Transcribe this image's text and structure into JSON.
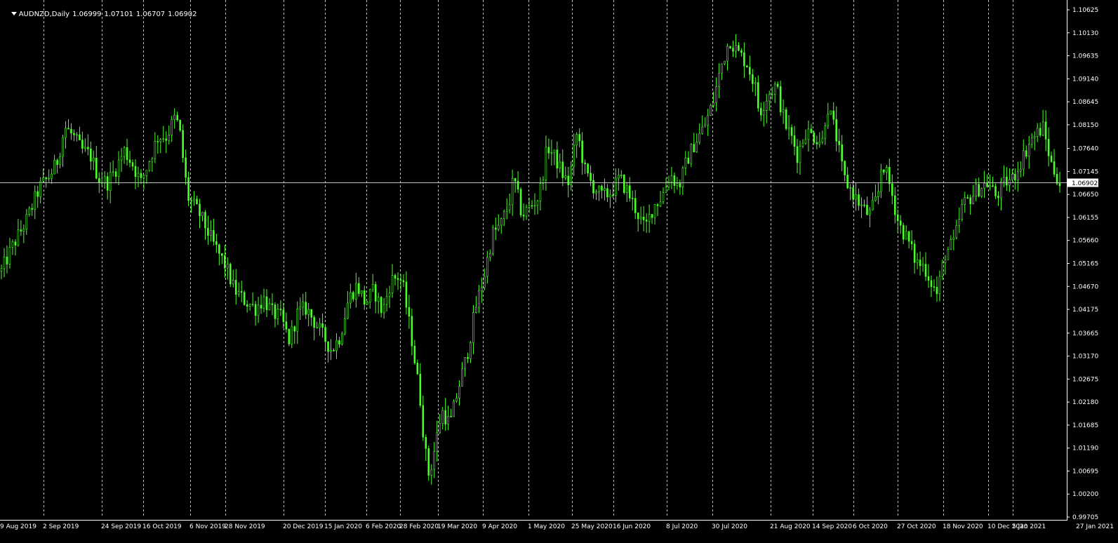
{
  "header": {
    "symbol": "AUDNZD,Daily",
    "open": "1.06999",
    "high": "1.07101",
    "low": "1.06707",
    "close": "1.06902"
  },
  "colors": {
    "background": "#000000",
    "grid": "#c0c0c0",
    "candle": "#4bff2a",
    "axis_text": "#ffffff",
    "price_line": "#c0c0c0",
    "price_label_bg": "#ffffff",
    "price_label_text": "#000000"
  },
  "chart_data": {
    "type": "candlestick",
    "symbol": "AUDNZD",
    "timeframe": "Daily",
    "current_price": 1.06902,
    "current_price_label": "1.06902",
    "ylim": [
      0.99705,
      1.10625
    ],
    "y_ticks": [
      "1.10625",
      "1.10130",
      "1.09635",
      "1.09140",
      "1.08645",
      "1.08150",
      "1.07640",
      "1.07145",
      "1.06650",
      "1.06155",
      "1.05660",
      "1.05165",
      "1.04670",
      "1.04175",
      "1.03665",
      "1.03170",
      "1.02675",
      "1.02180",
      "1.01685",
      "1.01190",
      "1.00695",
      "1.00200",
      "0.99705"
    ],
    "x_ticks": [
      "9 Aug 2019",
      "2 Sep 2019",
      "24 Sep 2019",
      "16 Oct 2019",
      "6 Nov 2019",
      "28 Nov 2019",
      "20 Dec 2019",
      "15 Jan 2020",
      "6 Feb 2020",
      "28 Feb 2020",
      "19 Mar 2020",
      "9 Apr 2020",
      "1 May 2020",
      "25 May 2020",
      "16 Jun 2020",
      "8 Jul 2020",
      "30 Jul 2020",
      "21 Aug 2020",
      "14 Sep 2020",
      "6 Oct 2020",
      "27 Oct 2020",
      "18 Nov 2020",
      "10 Dec 2020",
      "5 Jan 2021",
      "27 Jan 2021"
    ],
    "grid": "vertical dashed",
    "close_path": [
      [
        0,
        1.05
      ],
      [
        3,
        1.056
      ],
      [
        6,
        1.061
      ],
      [
        9,
        1.068
      ],
      [
        11,
        1.07
      ],
      [
        13,
        1.073
      ],
      [
        15,
        1.081
      ],
      [
        17,
        1.079
      ],
      [
        19,
        1.076
      ],
      [
        21,
        1.075
      ],
      [
        23,
        1.07
      ],
      [
        25,
        1.069
      ],
      [
        27,
        1.072
      ],
      [
        29,
        1.076
      ],
      [
        31,
        1.073
      ],
      [
        33,
        1.069
      ],
      [
        35,
        1.074
      ],
      [
        37,
        1.079
      ],
      [
        39,
        1.079
      ],
      [
        41,
        1.083
      ],
      [
        42,
        1.081
      ],
      [
        44,
        1.066
      ],
      [
        47,
        1.062
      ],
      [
        50,
        1.056
      ],
      [
        53,
        1.051
      ],
      [
        55,
        1.046
      ],
      [
        57,
        1.044
      ],
      [
        60,
        1.042
      ],
      [
        62,
        1.044
      ],
      [
        64,
        1.041
      ],
      [
        66,
        1.04
      ],
      [
        68,
        1.035
      ],
      [
        70,
        1.041
      ],
      [
        72,
        1.042
      ],
      [
        74,
        1.039
      ],
      [
        76,
        1.036
      ],
      [
        78,
        1.033
      ],
      [
        80,
        1.036
      ],
      [
        82,
        1.044
      ],
      [
        84,
        1.047
      ],
      [
        86,
        1.043
      ],
      [
        88,
        1.046
      ],
      [
        90,
        1.041
      ],
      [
        92,
        1.048
      ],
      [
        94,
        1.049
      ],
      [
        95,
        1.046
      ],
      [
        97,
        1.035
      ],
      [
        99,
        1.022
      ],
      [
        100,
        1.012
      ],
      [
        101,
        1.006
      ],
      [
        102,
        1.01
      ],
      [
        104,
        1.02
      ],
      [
        106,
        1.017
      ],
      [
        108,
        1.025
      ],
      [
        110,
        1.032
      ],
      [
        112,
        1.042
      ],
      [
        114,
        1.049
      ],
      [
        116,
        1.058
      ],
      [
        118,
        1.06
      ],
      [
        120,
        1.065
      ],
      [
        121,
        1.07
      ],
      [
        123,
        1.062
      ],
      [
        125,
        1.064
      ],
      [
        127,
        1.066
      ],
      [
        129,
        1.077
      ],
      [
        131,
        1.074
      ],
      [
        133,
        1.07
      ],
      [
        134,
        1.069
      ],
      [
        136,
        1.08
      ],
      [
        138,
        1.071
      ],
      [
        140,
        1.068
      ],
      [
        142,
        1.066
      ],
      [
        144,
        1.067
      ],
      [
        146,
        1.07
      ],
      [
        148,
        1.067
      ],
      [
        150,
        1.063
      ],
      [
        152,
        1.059
      ],
      [
        154,
        1.064
      ],
      [
        156,
        1.066
      ],
      [
        158,
        1.071
      ],
      [
        160,
        1.068
      ],
      [
        162,
        1.074
      ],
      [
        164,
        1.078
      ],
      [
        166,
        1.081
      ],
      [
        168,
        1.086
      ],
      [
        170,
        1.094
      ],
      [
        172,
        1.1
      ],
      [
        174,
        1.097
      ],
      [
        176,
        1.095
      ],
      [
        178,
        1.09
      ],
      [
        179,
        1.084
      ],
      [
        181,
        1.088
      ],
      [
        183,
        1.09
      ],
      [
        185,
        1.082
      ],
      [
        187,
        1.078
      ],
      [
        188,
        1.075
      ],
      [
        190,
        1.08
      ],
      [
        192,
        1.079
      ],
      [
        194,
        1.078
      ],
      [
        195,
        1.086
      ],
      [
        197,
        1.08
      ],
      [
        199,
        1.07
      ],
      [
        201,
        1.067
      ],
      [
        203,
        1.064
      ],
      [
        205,
        1.062
      ],
      [
        207,
        1.066
      ],
      [
        208,
        1.074
      ],
      [
        210,
        1.068
      ],
      [
        212,
        1.06
      ],
      [
        214,
        1.057
      ],
      [
        216,
        1.052
      ],
      [
        218,
        1.051
      ],
      [
        220,
        1.047
      ],
      [
        221,
        1.045
      ],
      [
        223,
        1.054
      ],
      [
        225,
        1.056
      ],
      [
        227,
        1.064
      ],
      [
        229,
        1.066
      ],
      [
        231,
        1.068
      ],
      [
        233,
        1.069
      ],
      [
        235,
        1.066
      ],
      [
        237,
        1.069
      ],
      [
        239,
        1.07
      ],
      [
        241,
        1.074
      ],
      [
        243,
        1.078
      ],
      [
        245,
        1.08
      ],
      [
        246,
        1.081
      ],
      [
        248,
        1.073
      ],
      [
        250,
        1.069
      ]
    ],
    "candle_count": 380
  }
}
